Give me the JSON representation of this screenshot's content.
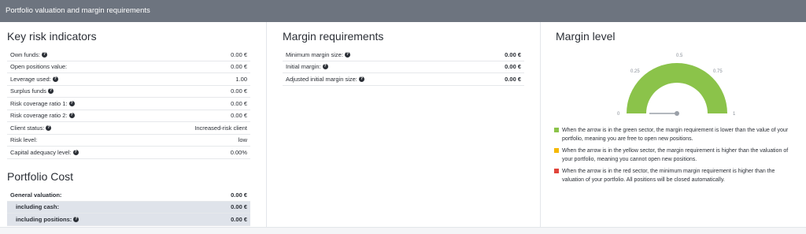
{
  "header": {
    "title": "Portfolio valuation and margin requirements"
  },
  "key_risk": {
    "title": "Key risk indicators",
    "rows": [
      {
        "label": "Own funds:",
        "help": true,
        "value": "0.00 €"
      },
      {
        "label": "Open positions value:",
        "help": false,
        "value": "0.00 €"
      },
      {
        "label": "Leverage used:",
        "help": true,
        "value": "1.00"
      },
      {
        "label": "Surplus funds",
        "help": true,
        "value": "0.00 €"
      },
      {
        "label": "Risk coverage ratio 1:",
        "help": true,
        "value": "0.00 €"
      },
      {
        "label": "Risk coverage ratio 2:",
        "help": true,
        "value": "0.00 €"
      },
      {
        "label": "Client status:",
        "help": true,
        "value": "Increased-risk client"
      },
      {
        "label": "Risk level:",
        "help": false,
        "value": "low"
      },
      {
        "label": "Capital adequacy level:",
        "help": true,
        "value": "0.00%"
      }
    ]
  },
  "portfolio_cost": {
    "title": "Portfolio Cost",
    "rows": [
      {
        "label": "General valuation:",
        "help": false,
        "value": "0.00 €"
      },
      {
        "label": "including cash:",
        "help": false,
        "value": "0.00 €"
      },
      {
        "label": "including positions:",
        "help": true,
        "value": "0.00 €"
      }
    ]
  },
  "margin_req": {
    "title": "Margin requirements",
    "rows": [
      {
        "label": "Minimum margin size:",
        "help": true,
        "value": "0.00 €"
      },
      {
        "label": "Initial margin:",
        "help": true,
        "value": "0.00 €"
      },
      {
        "label": "Adjusted initial margin size:",
        "help": true,
        "value": "0.00 €"
      }
    ]
  },
  "margin_level": {
    "title": "Margin level",
    "gauge": {
      "value": 0,
      "ticks": [
        "0",
        "0.25",
        "0.5",
        "0.75",
        "1"
      ],
      "fill_color": "#8bc34a"
    },
    "legend": [
      {
        "color": "#8bc34a",
        "text": "When the arrow is in the green sector, the margin requirement is lower than the value of your portfolio, meaning you are free to open new positions."
      },
      {
        "color": "#f5b800",
        "text": "When the arrow is in the yellow sector, the margin requirement is higher than the valuation of your portfolio, meaning you cannot open new positions."
      },
      {
        "color": "#e0443a",
        "text": "When the arrow is in the red sector, the minimum margin requirement is higher than the valuation of your portfolio. All positions will be closed automatically."
      }
    ]
  }
}
